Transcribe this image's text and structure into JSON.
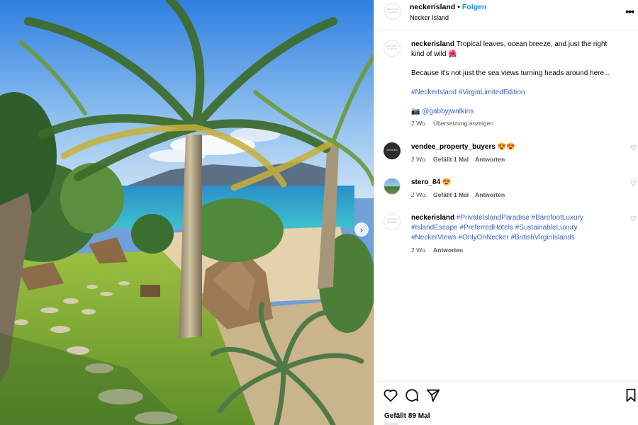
{
  "post": {
    "image_alt": "Tropical garden with palm trees and sea view",
    "next_icon": "›"
  },
  "header": {
    "username": "neckerisland",
    "separator": "•",
    "follow": "Folgen",
    "location": "Necker Island",
    "more_icon": "•••",
    "avatar_mark": "NECKER ISLAND"
  },
  "caption": {
    "username": "neckerisland",
    "text": " Tropical leaves, ocean breeze, and just the right kind of wild ",
    "emoji": "🌺",
    "line2": "Because it's not just the sea views turning heads around here...",
    "hashtags": "#NeckerIsland #VirginLimitedEdition",
    "camera": "📷",
    "credit": "@gabbyjwatkins",
    "time": "2 Wo.",
    "translate": "Übersetzung anzeigen"
  },
  "comments": [
    {
      "username": "vendee_property_buyers",
      "emoji": " 😍😍",
      "time": "2 Wo.",
      "likes": "Gefällt 1 Mal",
      "reply": "Antworten",
      "avatar_mark": "VENDÉE"
    },
    {
      "username": "stero_84",
      "emoji": " 😍",
      "time": "2 Wo.",
      "likes": "Gefällt 1 Mal",
      "reply": "Antworten"
    },
    {
      "username": "neckerisland",
      "text": " #PrivateIslandParadise #BarefootLuxury #IslandEscape #PreferredHotels #SustainableLuxury #NeckerViews #OnlyOnNecker #BritishVirginIslands",
      "time": "2 Wo.",
      "reply": "Antworten",
      "avatar_mark": "NECKER ISLAND"
    }
  ],
  "actions": {
    "likes": "Gefällt 89 Mal",
    "heart_icon": "heart-outline",
    "comment_icon": "speech-bubble",
    "share_icon": "paper-plane",
    "save_icon": "bookmark",
    "comment_heart": "♡"
  },
  "colors": {
    "link": "#3a60c7",
    "follow": "#0095f6"
  }
}
